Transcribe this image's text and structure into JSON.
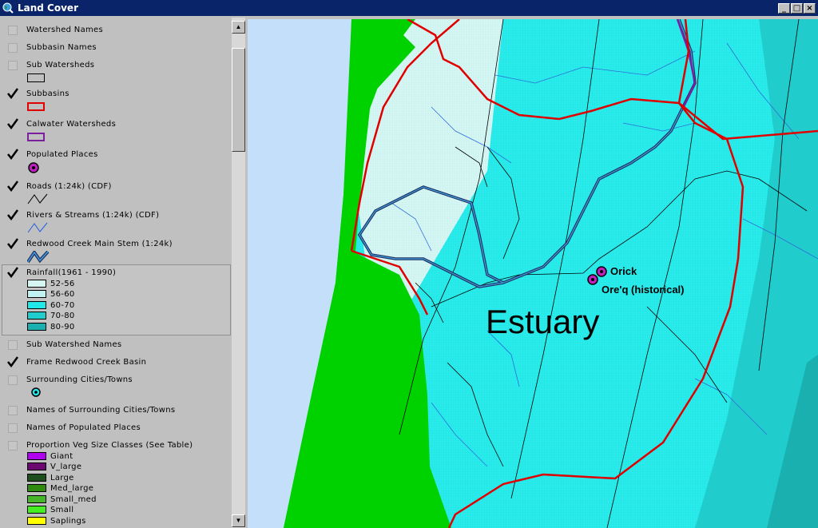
{
  "window": {
    "title": "Land Cover",
    "minimize": "_",
    "maximize": "□",
    "close": "×"
  },
  "colors": {
    "subbasin_border": "#e00000",
    "calwater_border": "#7a1fa0",
    "rain_52_56": "#d6f6f4",
    "rain_56_60": "#bff2f0",
    "rain_60_70": "#22e8e8",
    "rain_70_80": "#20cccc",
    "rain_80_90": "#1ab0b0",
    "land_green": "#00d200",
    "ocean": "#c4dffa"
  },
  "toc": {
    "layers": [
      {
        "label": "Watershed Names",
        "checked": false
      },
      {
        "label": "Subbasin Names",
        "checked": false
      },
      {
        "label": "Sub Watersheds",
        "checked": false
      },
      {
        "label": "Subbasins",
        "checked": true
      },
      {
        "label": "Calwater Watersheds",
        "checked": true
      },
      {
        "label": "Populated Places",
        "checked": true
      },
      {
        "label": "Roads (1:24k) (CDF)",
        "checked": true
      },
      {
        "label": "Rivers & Streams (1:24k) (CDF)",
        "checked": true
      },
      {
        "label": "Redwood Creek Main Stem (1:24k)",
        "checked": true
      },
      {
        "label": "Rainfall(1961 - 1990)",
        "checked": true
      },
      {
        "label": "Sub Watershed Names",
        "checked": false
      },
      {
        "label": "Frame Redwood Creek Basin",
        "checked": true
      },
      {
        "label": "Surrounding Cities/Towns",
        "checked": false
      },
      {
        "label": "Names of Surrounding Cities/Towns",
        "checked": false
      },
      {
        "label": "Names of Populated Places",
        "checked": false
      },
      {
        "label": "Proportion Veg Size Classes (See Table)",
        "checked": false
      }
    ],
    "rainfall_classes": [
      {
        "label": "52-56",
        "color": "#d6f6f4"
      },
      {
        "label": "56-60",
        "color": "#bff2f0"
      },
      {
        "label": "60-70",
        "color": "#22e8e8"
      },
      {
        "label": "70-80",
        "color": "#20cccc"
      },
      {
        "label": "80-90",
        "color": "#1ab0b0"
      }
    ],
    "veg_classes": [
      {
        "label": "Giant",
        "color": "#b000f0"
      },
      {
        "label": "V_large",
        "color": "#6a0a70"
      },
      {
        "label": "Large",
        "color": "#1e4e1e"
      },
      {
        "label": "Med_large",
        "color": "#2f8a10"
      },
      {
        "label": "Small_med",
        "color": "#45b52a"
      },
      {
        "label": "Small",
        "color": "#44ee22"
      },
      {
        "label": "Saplings",
        "color": "#ffff00"
      }
    ]
  },
  "map": {
    "region_label": "Estuary",
    "places": [
      {
        "name": "Orick"
      },
      {
        "name": "Ore'q (historical)"
      }
    ]
  },
  "scrollbar": {
    "up": "▲",
    "down": "▼"
  }
}
